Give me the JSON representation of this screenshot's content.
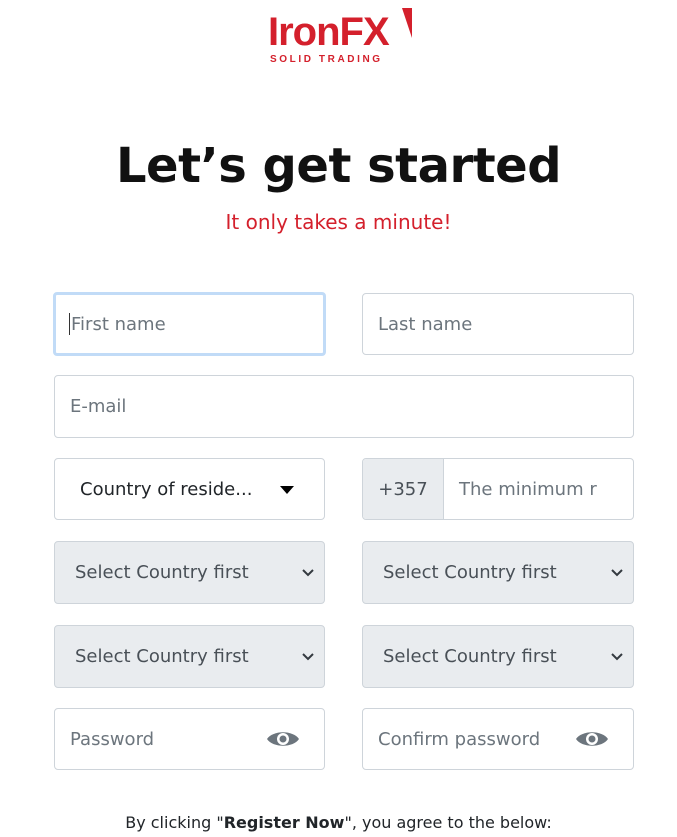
{
  "logo": {
    "name": "IronFX",
    "tagline": "SOLID TRADING",
    "color": "#d4202c"
  },
  "header": {
    "title": "Let’s get started",
    "subtitle": "It only takes a minute!"
  },
  "form": {
    "first_name_placeholder": "First name",
    "last_name_placeholder": "Last name",
    "email_placeholder": "E-mail",
    "country_label": "Country of reside...",
    "phone_prefix": "+357",
    "phone_placeholder": "The minimum r",
    "select_1": "Select Country first",
    "select_2": "Select Country first",
    "select_3": "Select Country first",
    "select_4": "Select Country first",
    "password_placeholder": "Password",
    "confirm_password_placeholder": "Confirm password"
  },
  "terms": {
    "prefix": "By clicking \"",
    "button_name": "Register Now",
    "suffix": "\", you agree to the below:"
  },
  "icons": {
    "password_toggle": "eye-icon",
    "select_arrow": "chevron-down-icon",
    "dropdown_arrow": "caret-down-icon"
  }
}
